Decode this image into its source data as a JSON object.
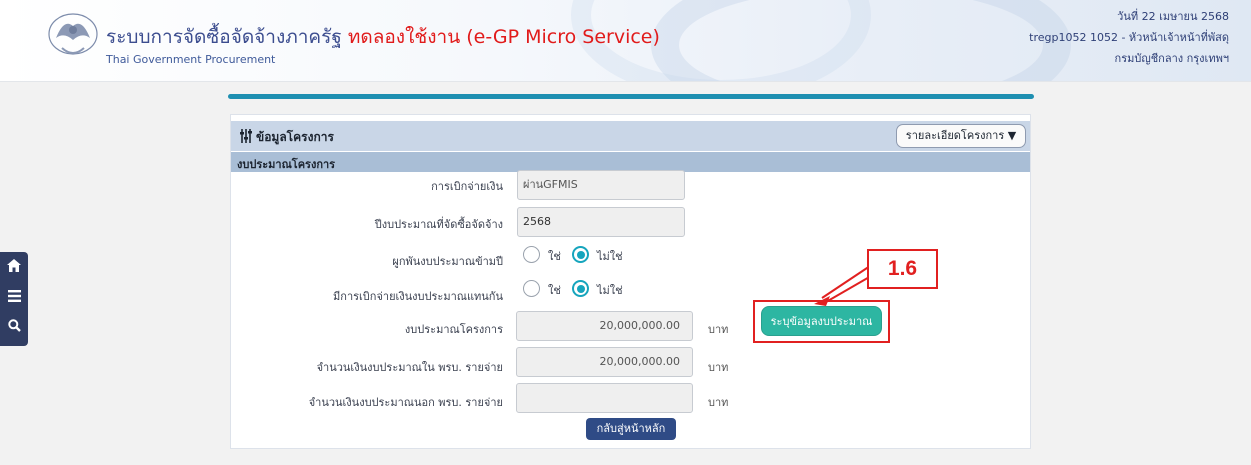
{
  "header": {
    "title_main": "ระบบการจัดซื้อจัดจ้างภาครัฐ ",
    "title_trial": "ทดลองใช้งาน (e-GP Micro Service)",
    "subtitle": "Thai Government Procurement",
    "date": "วันที่ 22 เมษายน 2568",
    "user": "tregp1052 1052 - หัวหน้าเจ้าหน้าที่พัสดุ",
    "org": "กรมบัญชีกลาง กรุงเทพฯ"
  },
  "sidebar": {
    "icons": [
      "home-icon",
      "menu-icon",
      "search-icon"
    ]
  },
  "panel": {
    "title": "ข้อมูลโครงการ",
    "details_dropdown": "รายละเอียดโครงการ ▼",
    "section": "งบประมาณโครงการ"
  },
  "form": {
    "disbursement_label": "การเบิกจ่ายเงิน",
    "disbursement_value": "ผ่านGFMIS",
    "fiscal_year_label": "ปีงบประมาณที่จัดซื้อจัดจ้าง",
    "fiscal_year_value": "2568",
    "multi_year_label": "ผูกพันงบประมาณข้ามปี",
    "multi_year_yes": "ใช่",
    "multi_year_no": "ไม่ใช่",
    "multi_year_selected": "no",
    "substitute_label": "มีการเบิกจ่ายเงินงบประมาณแทนกัน",
    "substitute_yes": "ใช่",
    "substitute_no": "ไม่ใช่",
    "substitute_selected": "no",
    "budget_label": "งบประมาณโครงการ",
    "budget_value": "20,000,000.00",
    "budget_unit": "บาท",
    "in_act_label": "จำนวนเงินงบประมาณใน พรบ. รายจ่าย",
    "in_act_value": "20,000,000.00",
    "in_act_unit": "บาท",
    "out_act_label": "จำนวนเงินงบประมาณนอก พรบ. รายจ่าย",
    "out_act_value": "",
    "out_act_unit": "บาท"
  },
  "buttons": {
    "specify_budget": "ระบุข้อมูลงบประมาณ",
    "back_home": "กลับสู่หน้าหลัก"
  },
  "annotation": {
    "callout": "1.6",
    "color": "#e12020"
  },
  "colors": {
    "accent": "#1e8fb1",
    "teal": "#2db6a2",
    "navy": "#2f4b86"
  }
}
